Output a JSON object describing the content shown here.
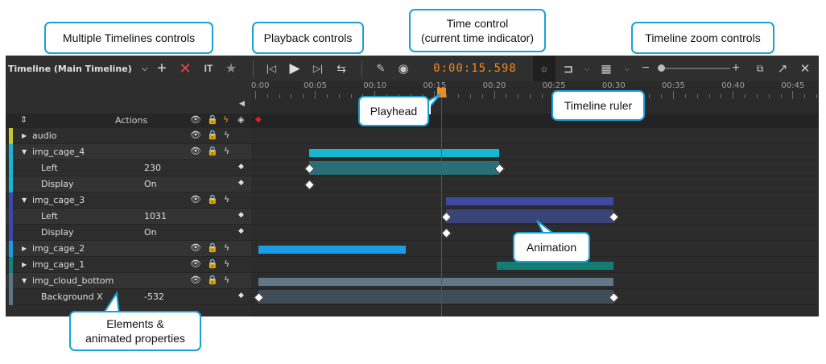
{
  "callouts": {
    "multiple_timelines": "Multiple Timelines controls",
    "playback": "Playback controls",
    "time_control_line1": "Time control",
    "time_control_line2": "(current time indicator)",
    "zoom": "Timeline zoom controls",
    "playhead": "Playhead",
    "ruler": "Timeline ruler",
    "animation": "Animation",
    "elements_line1": "Elements &",
    "elements_line2": "animated properties"
  },
  "toolbar": {
    "timeline_name": "Timeline (Main Timeline)",
    "current_time": "0:00:15.598",
    "icons": [
      "chevron-down-icon",
      "plus-icon",
      "delete-icon",
      "rename-icon",
      "star-icon",
      "skip-start-icon",
      "play-icon",
      "skip-end-icon",
      "loop-icon",
      "pen-icon",
      "record-icon",
      "lightbulb-icon",
      "snap-icon",
      "grid-icon",
      "zoom-out-icon",
      "zoom-in-icon",
      "fit-icon",
      "popout-icon",
      "close-icon"
    ]
  },
  "ruler": {
    "ticks": [
      "0:00",
      "00:05",
      "00:10",
      "00:15",
      "00:20",
      "00:25",
      "00:30",
      "00:35",
      "00:40",
      "00:45"
    ]
  },
  "header": {
    "actions_label": "Actions"
  },
  "rows": [
    {
      "name": "audio",
      "type": "element",
      "expanded": false,
      "color": "#c9c62a",
      "value": ""
    },
    {
      "name": "img_cage_4",
      "type": "element",
      "expanded": true,
      "color": "#19b5d4",
      "value": ""
    },
    {
      "name": "Left",
      "type": "property",
      "value": "230"
    },
    {
      "name": "Display",
      "type": "property",
      "value": "On"
    },
    {
      "name": "img_cage_3",
      "type": "element",
      "expanded": true,
      "color": "#3c47a8",
      "value": ""
    },
    {
      "name": "Left",
      "type": "property",
      "value": "1031"
    },
    {
      "name": "Display",
      "type": "property",
      "value": "On"
    },
    {
      "name": "img_cage_2",
      "type": "element",
      "expanded": false,
      "color": "#1a9de0",
      "value": ""
    },
    {
      "name": "img_cage_1",
      "type": "element",
      "expanded": false,
      "color": "#17827a",
      "value": ""
    },
    {
      "name": "img_cloud_bottom",
      "type": "element",
      "expanded": true,
      "color": "#5e7384",
      "value": ""
    },
    {
      "name": "Background X",
      "type": "property",
      "value": "-532"
    }
  ],
  "tracks": [
    {
      "row": 1,
      "start": 4.5,
      "end": 20.4,
      "color": "#17b6d2"
    },
    {
      "row": 2,
      "start": 4.5,
      "end": 20.4,
      "color": "#2a6e78",
      "keys": [
        4.5,
        20.4
      ]
    },
    {
      "row": 3,
      "keys": [
        4.5
      ]
    },
    {
      "row": 4,
      "start": 16.0,
      "end": 30.0,
      "color": "#3d49a2"
    },
    {
      "row": 5,
      "start": 16.0,
      "end": 30.0,
      "color": "#3a4478",
      "keys": [
        16.0,
        30.0
      ]
    },
    {
      "row": 6,
      "keys": [
        16.0
      ]
    },
    {
      "row": 7,
      "start": 0.3,
      "end": 12.6,
      "color": "#1a9de5"
    },
    {
      "row": 8,
      "start": 20.2,
      "end": 30.0,
      "color": "#137d74"
    },
    {
      "row": 9,
      "start": 0.3,
      "end": 30.0,
      "color": "#617687"
    },
    {
      "row": 10,
      "start": 0.3,
      "end": 30.0,
      "color": "#3f4d58",
      "keys": [
        0.3,
        30.0
      ]
    }
  ],
  "playhead_seconds": 15.598
}
